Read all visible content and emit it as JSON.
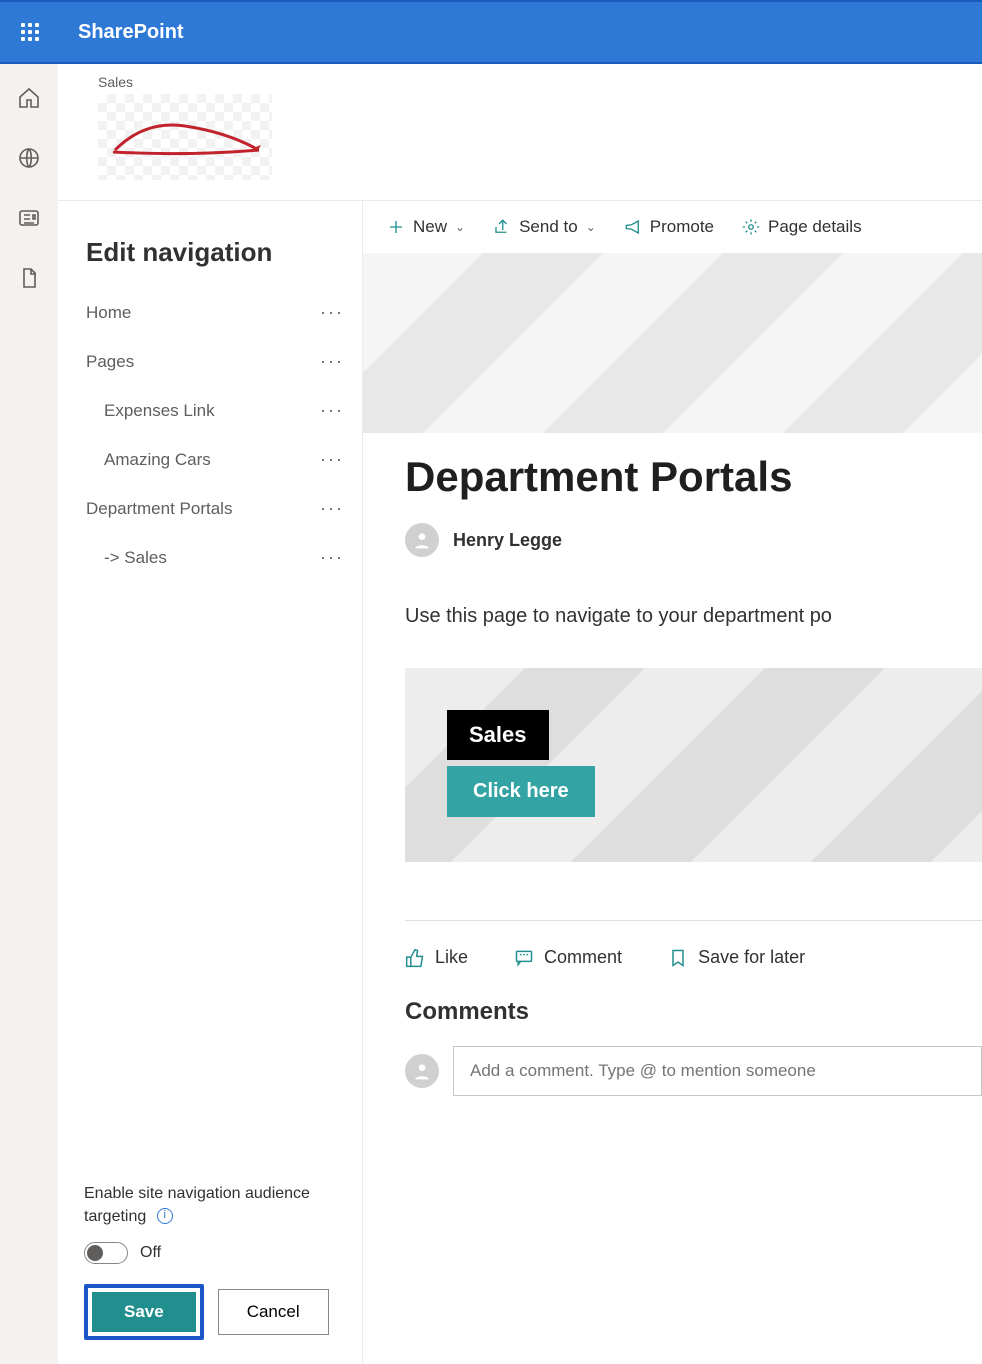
{
  "header": {
    "app_name": "SharePoint"
  },
  "site": {
    "label": "Sales"
  },
  "nav": {
    "title": "Edit navigation",
    "items": [
      {
        "label": "Home",
        "sub": false
      },
      {
        "label": "Pages",
        "sub": false
      },
      {
        "label": "Expenses Link",
        "sub": true
      },
      {
        "label": "Amazing Cars",
        "sub": true
      },
      {
        "label": "Department Portals",
        "sub": false
      },
      {
        "label": "-> Sales",
        "sub": true
      }
    ],
    "targeting_label": "Enable site navigation audience targeting",
    "toggle_state": "Off",
    "save_label": "Save",
    "cancel_label": "Cancel"
  },
  "cmd": {
    "new": "New",
    "send_to": "Send to",
    "promote": "Promote",
    "page_details": "Page details"
  },
  "page": {
    "title": "Department Portals",
    "author": "Henry Legge",
    "description": "Use this page to navigate to your department po",
    "card_title": "Sales",
    "card_button": "Click here"
  },
  "social": {
    "like": "Like",
    "comment": "Comment",
    "save": "Save for later"
  },
  "comments": {
    "heading": "Comments",
    "placeholder": "Add a comment. Type @ to mention someone"
  }
}
